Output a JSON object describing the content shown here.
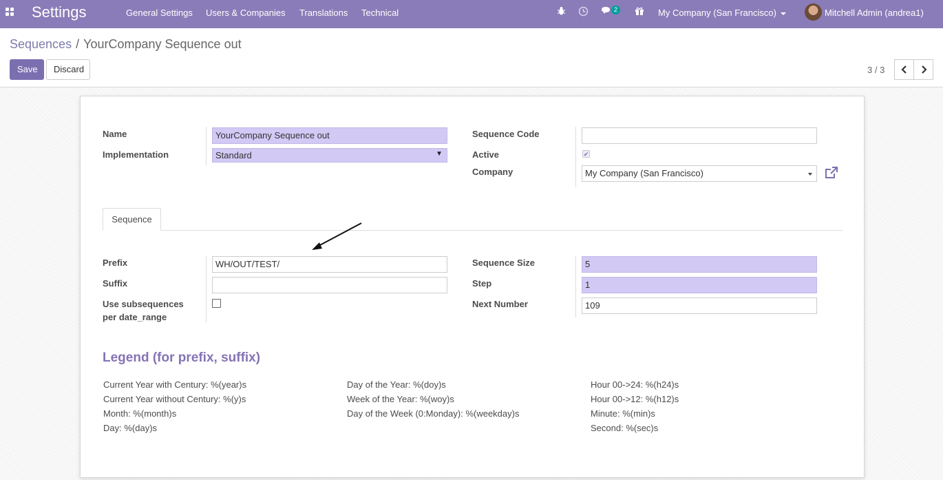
{
  "navbar": {
    "app_title": "Settings",
    "menus": [
      "General Settings",
      "Users & Companies",
      "Translations",
      "Technical"
    ],
    "messages_badge": "2",
    "company": "My Company (San Francisco)",
    "user": "Mitchell Admin (andrea1)"
  },
  "breadcrumb": {
    "parent": "Sequences",
    "separator": "/",
    "current": "YourCompany Sequence out"
  },
  "buttons": {
    "save": "Save",
    "discard": "Discard"
  },
  "pager": {
    "text": "3 / 3",
    "prev": "‹",
    "next": "›"
  },
  "form": {
    "name_label": "Name",
    "name_value": "YourCompany Sequence out",
    "implementation_label": "Implementation",
    "implementation_value": "Standard",
    "sequence_code_label": "Sequence Code",
    "sequence_code_value": "",
    "active_label": "Active",
    "active_checked": true,
    "company_label": "Company",
    "company_value": "My Company (San Francisco)"
  },
  "tab": {
    "label": "Sequence"
  },
  "sequence": {
    "prefix_label": "Prefix",
    "prefix_value": "WH/OUT/TEST/",
    "suffix_label": "Suffix",
    "suffix_value": "",
    "use_subsequences_label_1": "Use subsequences",
    "use_subsequences_label_2": "per date_range",
    "use_subsequences_checked": false,
    "size_label": "Sequence Size",
    "size_value": "5",
    "step_label": "Step",
    "step_value": "1",
    "next_label": "Next Number",
    "next_value": "109"
  },
  "legend": {
    "title": "Legend (for prefix, suffix)",
    "col1": [
      "Current Year with Century: %(year)s",
      "Current Year without Century: %(y)s",
      "Month: %(month)s",
      "Day: %(day)s"
    ],
    "col2": [
      "Day of the Year: %(doy)s",
      "Week of the Year: %(woy)s",
      "Day of the Week (0:Monday): %(weekday)s"
    ],
    "col3": [
      "Hour 00->24: %(h24)s",
      "Hour 00->12: %(h12)s",
      "Minute: %(min)s",
      "Second: %(sec)s"
    ]
  },
  "colors": {
    "navbar": "#8a7cb8",
    "primary": "#7c6fb0",
    "required_field": "#d2c9f5",
    "legend_title": "#8573b4"
  }
}
